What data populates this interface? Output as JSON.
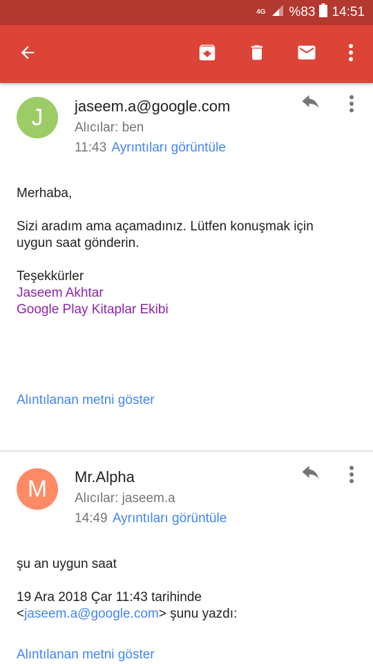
{
  "status_bar": {
    "network": "4G",
    "battery": "%83",
    "time": "14:51"
  },
  "toolbar": {
    "back_icon": "arrow-back-icon",
    "archive_icon": "archive-icon",
    "delete_icon": "trash-icon",
    "mail_icon": "mail-icon",
    "more_icon": "more-vert-icon"
  },
  "colors": {
    "toolbar": "#db4437",
    "status_bar": "#b33830",
    "link": "#4285f4",
    "signature": "#8e24aa",
    "avatar_j": "#9ccc65",
    "avatar_m": "#ff8a65"
  },
  "messages": [
    {
      "avatar_letter": "J",
      "sender": "jaseem.a@google.com",
      "recipients": "Alıcılar: ben",
      "time": "11:43",
      "details_link": "Ayrıntıları görüntüle",
      "greeting": "Merhaba,",
      "body_line1": "Sizi aradım ama açamadınız. Lütfen konuşmak için",
      "body_line2": "uygun saat gönderin.",
      "thanks": "Teşekkürler",
      "signature_name": "Jaseem Akhtar",
      "signature_team": "Google Play Kitaplar Ekibi",
      "quote_link": "Alıntılanan metni göster"
    },
    {
      "avatar_letter": "M",
      "sender": "Mr.Alpha",
      "recipients": "Alıcılar: jaseem.a",
      "time": "14:49",
      "details_link": "Ayrıntıları görüntüle",
      "body_line1": "şu an uygun saat",
      "quote_header_line1": "19 Ara 2018 Çar 11:43 tarihinde",
      "quote_open": "<",
      "quote_email": "jaseem.a@google.com",
      "quote_close": "> şunu yazdı:",
      "quote_link": "Alıntılanan metni göster"
    }
  ]
}
